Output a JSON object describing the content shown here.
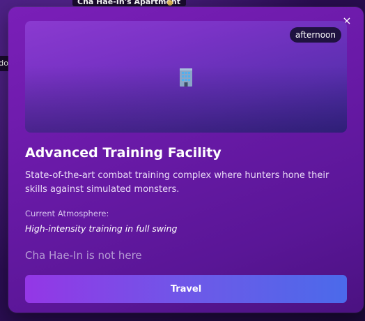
{
  "background": {
    "location_label": "Cha Hae-In's Apartment",
    "left_label_fragment": "do"
  },
  "modal": {
    "close_glyph": "×",
    "time_of_day": "afternoon",
    "hero_icon": "office-building-icon",
    "title": "Advanced Training Facility",
    "description": "State-of-the-art combat training complex where hunters hone their skills against simulated monsters.",
    "atmosphere_label": "Current Atmosphere:",
    "atmosphere_value": "High-intensity training in full swing",
    "presence_status": "Cha Hae-In is not here",
    "travel_label": "Travel"
  },
  "colors": {
    "modal_purple": "#6a1aa8",
    "button_start": "#9437e6",
    "button_end": "#4b6aea",
    "badge_bg": "#1f1240",
    "muted_text": "#b59bd4"
  }
}
